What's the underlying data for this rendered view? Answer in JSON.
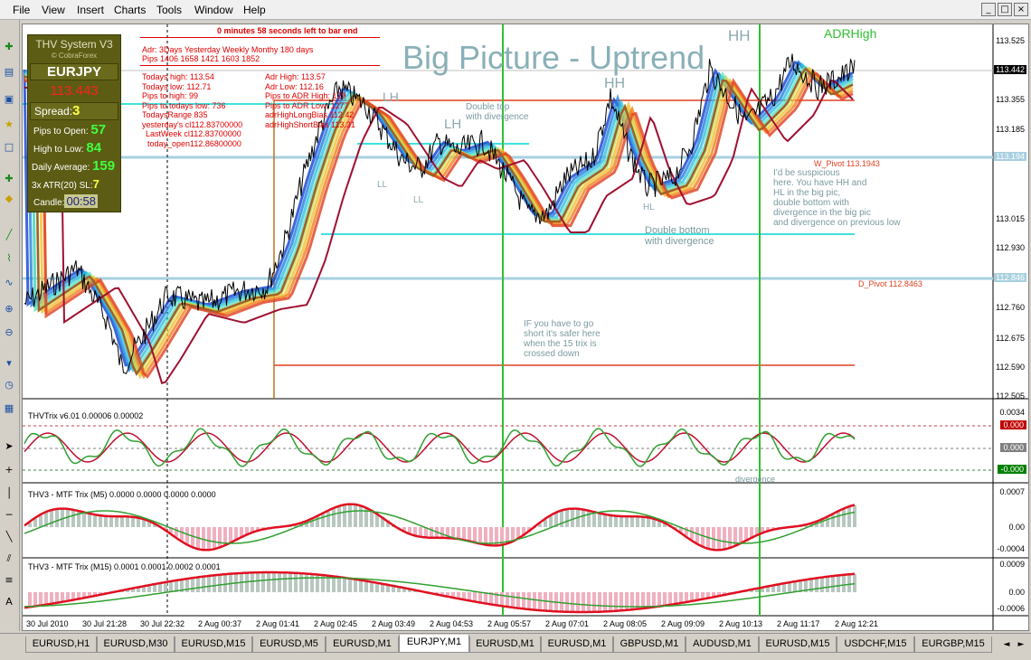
{
  "menu": [
    "File",
    "Edit",
    "View",
    "Insert",
    "Charts",
    "Tools",
    "Window",
    "Help"
  ],
  "window_buttons": [
    "_",
    "□",
    "×"
  ],
  "thv": {
    "title": "THV System V3",
    "sub": "© CobraForex",
    "symbol": "EURJPY",
    "price": "113.443",
    "spread_label": "Spread:",
    "spread_value": "3",
    "pips_open_label": "Pips to Open:",
    "pips_open_value": "57",
    "high_low_label": "High to Low:",
    "high_low_value": "84",
    "daily_avg_label": "Daily Average:",
    "daily_avg_value": "159",
    "atr_label": "3x ATR(20) SL:",
    "atr_value": "7",
    "candle_label": "Candle:",
    "candle_value": "00:58"
  },
  "info_block": {
    "bar_end": "0 minutes 58 seconds left to bar end",
    "header_line": "Adr:  3Days  Yesterday      Weekly      Monthy    180 days",
    "pips_line": "Pips  1406    1658               1421         1603      1852",
    "stats_left": [
      "Todays high:          113.54",
      "Todays low:           112.71",
      "Pips to high:              99",
      "Pips to todays low: 736",
      "TodaysRange             835",
      "yesterday's cl112.83700000",
      "LastWeek cl112.83700000",
      "today_open112.86800000"
    ],
    "stats_right": [
      "Adr High:              113.57",
      "Adr Low:               112.16",
      "Pips to ADR High:  129",
      "Pips to ADR Low:   1277",
      "adrHighLongBias  112.42",
      "adrHighShortBias   113.31"
    ]
  },
  "annotations": {
    "big_picture": "Big Picture - Uptrend",
    "hh1": "HH",
    "adr_high": "ADRHigh",
    "hh2": "HH",
    "lh1": "LH",
    "lh2": "LH",
    "double_top": "Double top\nwith divergence",
    "ll1": "LL",
    "ll2": "LL",
    "hl": "HL",
    "double_bottom": "Double bottom\nwith divergence",
    "suspicious": "I'd be suspicious\nhere. You have HH and\nHL in the big pic,\ndouble bottom with\ndivergence in the big pic\nand divergence on previous low",
    "short_safer": "IF you have to go\nshort it's safer here\nwhen the 15 trix is\ncrossed down",
    "w_pivot": "W_Pivot 113.1943",
    "d_pivot": "D_Pivot 112.8463",
    "divergence": "divergence"
  },
  "price_axis": [
    "113.525",
    "113.355",
    "113.185",
    "113.015",
    "112.930",
    "112.845",
    "112.760",
    "112.675",
    "112.590",
    "112.505"
  ],
  "price_marks": {
    "current": "113.442",
    "w_pivot": "113.194",
    "d_pivot": "112.846"
  },
  "indicators": {
    "trix": {
      "title": "THVTrix v6.01 0.00006 0.00002",
      "axis": [
        "0.0034",
        "0.000",
        "0.000",
        "-0.000"
      ]
    },
    "mtf_m5": {
      "title": "THV3 - MTF Trix (M5) 0.0000 0.0000 0.0000 0.0000",
      "axis": [
        "0.0007",
        "0.00",
        "-0.0004"
      ]
    },
    "mtf_m15": {
      "title": "THV3 - MTF Trix (M15) 0.0001 0.0001 0.0002 0.0001",
      "axis": [
        "0.0009",
        "0.00",
        "-0.0006"
      ]
    }
  },
  "time_axis": [
    "30 Jul 2010",
    "30 Jul 21:28",
    "30 Jul 22:32",
    "2 Aug 00:37",
    "2 Aug 01:41",
    "2 Aug 02:45",
    "2 Aug 03:49",
    "2 Aug 04:53",
    "2 Aug 05:57",
    "2 Aug 07:01",
    "2 Aug 08:05",
    "2 Aug 09:09",
    "2 Aug 10:13",
    "2 Aug 11:17",
    "2 Aug 12:21"
  ],
  "tabs": [
    "EURUSD,H1",
    "EURUSD,M30",
    "EURUSD,M15",
    "EURUSD,M5",
    "EURUSD,M1",
    "EURJPY,M1",
    "EURUSD,M1",
    "EURUSD,M1",
    "GBPUSD,M1",
    "AUDUSD,M1",
    "EURUSD,M15",
    "USDCHF,M15",
    "EURGBP,M15"
  ],
  "tab_nav": [
    "◄",
    "►"
  ],
  "toolbar_icons": [
    "plus-icon",
    "chart-icon",
    "arrow-icon",
    "star-icon",
    "window-icon",
    "plus-icon",
    "diamond-icon",
    "line-icon",
    "trend-icon",
    "zoom-in-icon",
    "zoom-out-icon",
    "dropdown-icon",
    "clock-icon",
    "grid-icon",
    "cursor-icon",
    "crosshair-icon",
    "vline-icon",
    "hline-icon",
    "tline-icon",
    "channel-icon",
    "fib-icon",
    "text-icon",
    "label-icon",
    "arrow-mark-icon"
  ]
}
